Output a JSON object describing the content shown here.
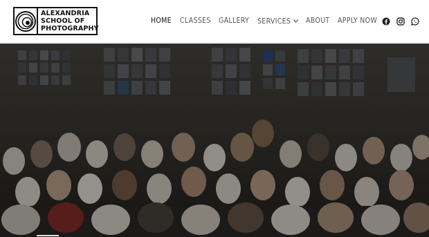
{
  "logo": {
    "lines": [
      "ALEXANDRIA",
      "SCHOOL OF",
      "PHOTOGRAPHY"
    ]
  },
  "nav": {
    "items": [
      {
        "label": "HOME",
        "active": true
      },
      {
        "label": "CLASSES",
        "active": false
      },
      {
        "label": "GALLERY",
        "active": false
      },
      {
        "label": "SERVICES",
        "active": false,
        "has_dropdown": true
      },
      {
        "label": "ABOUT",
        "active": false
      },
      {
        "label": "APPLY NOW",
        "active": false
      }
    ]
  },
  "social": {
    "icons": [
      "facebook-icon",
      "instagram-icon",
      "whatsapp-icon"
    ]
  },
  "colors": {
    "nav_text": "#555555",
    "nav_active": "#111111",
    "hero_overlay": "rgba(0,0,0,0.38)"
  }
}
